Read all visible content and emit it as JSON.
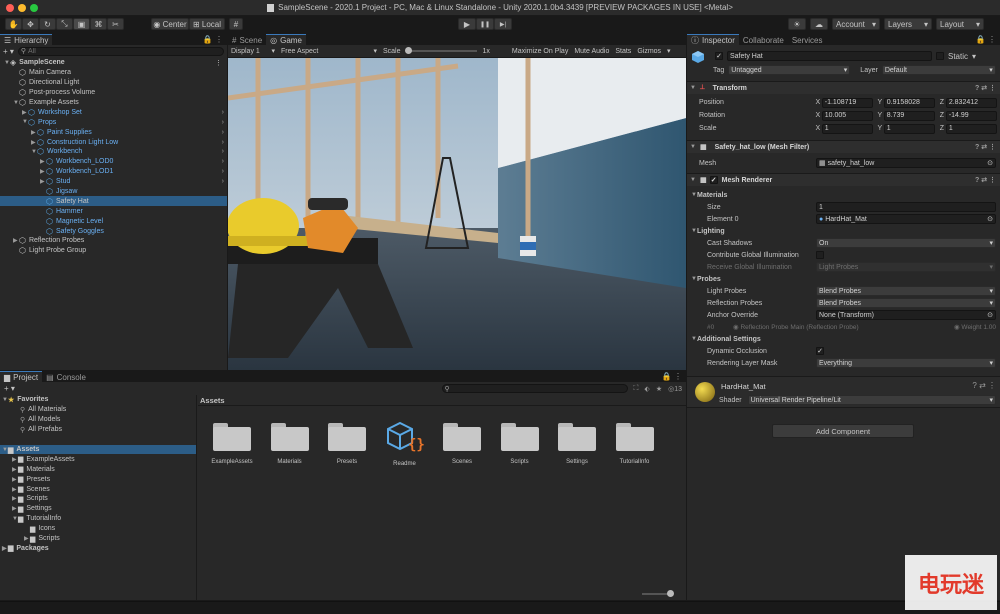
{
  "window": {
    "title": "SampleScene - 2020.1 Project - PC, Mac & Linux Standalone - Unity 2020.1.0b4.3439 [PREVIEW PACKAGES IN USE] <Metal>"
  },
  "colors": {
    "accent": "#3a79bb",
    "selection": "#2c5d87",
    "prefab_blue": "#6ab0f3",
    "panel": "#282828",
    "close": "#fe5f57",
    "minimize": "#febc2e",
    "maximize": "#28c840"
  },
  "toolbar": {
    "center": "Center",
    "local": "Local",
    "account": "Account",
    "layers": "Layers",
    "layout": "Layout",
    "play_icon": "▶",
    "pause_icon": "❚❚",
    "step_icon": "▶|"
  },
  "hierarchy": {
    "tab": "Hierarchy",
    "add": "+ ▾",
    "search_placeholder": "All",
    "rows": [
      {
        "label": "SampleScene",
        "indent": 0,
        "bold": true,
        "expanded": true
      },
      {
        "label": "Main Camera",
        "indent": 1
      },
      {
        "label": "Directional Light",
        "indent": 1
      },
      {
        "label": "Post-process Volume",
        "indent": 1
      },
      {
        "label": "Example Assets",
        "indent": 1,
        "expanded": true
      },
      {
        "label": "Workshop Set",
        "indent": 2,
        "prefab": true,
        "collapsed": true
      },
      {
        "label": "Props",
        "indent": 2,
        "prefab": true,
        "expanded": true
      },
      {
        "label": "Paint Supplies",
        "indent": 3,
        "prefab": true,
        "collapsed": true
      },
      {
        "label": "Construction Light Low",
        "indent": 3,
        "prefab": true,
        "collapsed": true
      },
      {
        "label": "Workbench",
        "indent": 3,
        "prefab": true,
        "expanded": true
      },
      {
        "label": "Workbench_LOD0",
        "indent": 4,
        "prefab": true,
        "collapsed": true
      },
      {
        "label": "Workbench_LOD1",
        "indent": 4,
        "prefab": true,
        "collapsed": true
      },
      {
        "label": "Stud",
        "indent": 4,
        "prefab": true,
        "collapsed": true
      },
      {
        "label": "Jigsaw",
        "indent": 4,
        "prefab": true
      },
      {
        "label": "Safety Hat",
        "indent": 4,
        "prefab": true,
        "selected": true
      },
      {
        "label": "Hammer",
        "indent": 4,
        "prefab": true
      },
      {
        "label": "Magnetic Level",
        "indent": 4,
        "prefab": true
      },
      {
        "label": "Safety Goggles",
        "indent": 4,
        "prefab": true
      },
      {
        "label": "Reflection Probes",
        "indent": 1,
        "collapsed": true
      },
      {
        "label": "Light Probe Group",
        "indent": 1
      }
    ]
  },
  "scene": {
    "tabs": [
      "Scene",
      "Game"
    ],
    "display": "Display 1",
    "aspect": "Free Aspect",
    "scale_label": "Scale",
    "scale_value": "1x",
    "maximize": "Maximize On Play",
    "mute": "Mute Audio",
    "stats": "Stats",
    "gizmos": "Gizmos"
  },
  "inspector": {
    "tabs": [
      "Inspector",
      "Collaborate",
      "Services"
    ],
    "object_name": "Safety Hat",
    "static": "Static",
    "tag_label": "Tag",
    "tag": "Untagged",
    "layer_label": "Layer",
    "layer": "Default",
    "transform": {
      "title": "Transform",
      "position_label": "Position",
      "rotation_label": "Rotation",
      "scale_label": "Scale",
      "x_label": "X",
      "y_label": "Y",
      "z_label": "Z",
      "pos": [
        "-1.108719",
        "0.9158028",
        "2.832412"
      ],
      "rot": [
        "10.005",
        "8.739",
        "-14.99"
      ],
      "scl": [
        "1",
        "1",
        "1"
      ]
    },
    "mesh_filter": {
      "title": "Safety_hat_low (Mesh Filter)",
      "mesh_label": "Mesh",
      "mesh": "safety_hat_low"
    },
    "mesh_renderer": {
      "title": "Mesh Renderer",
      "materials": "Materials",
      "size_label": "Size",
      "size": "1",
      "element_label": "Element 0",
      "element": "HardHat_Mat",
      "lighting": "Lighting",
      "cast_label": "Cast Shadows",
      "cast": "On",
      "contrib_label": "Contribute Global Illumination",
      "receive_label": "Receive Global Illumination",
      "receive": "Light Probes",
      "probes": "Probes",
      "lp_label": "Light Probes",
      "lp": "Blend Probes",
      "rp_label": "Reflection Probes",
      "rp": "Blend Probes",
      "anchor_label": "Anchor Override",
      "anchor": "None (Transform)",
      "probe_index": "#0",
      "probe_name": "Reflection Probe Main (Reflection Probe)",
      "probe_weight": "Weight 1.00",
      "additional": "Additional Settings",
      "dyn_label": "Dynamic Occlusion",
      "rlm_label": "Rendering Layer Mask",
      "rlm": "Everything"
    },
    "material": {
      "name": "HardHat_Mat",
      "shader_label": "Shader",
      "shader": "Universal Render Pipeline/Lit"
    },
    "add_component": "Add Component"
  },
  "project": {
    "tabs": [
      "Project",
      "Console"
    ],
    "add": "+ ▾",
    "hidden_count": "13",
    "favorites": {
      "title": "Favorites",
      "items": [
        "All Materials",
        "All Models",
        "All Prefabs"
      ]
    },
    "assets": {
      "title": "Assets",
      "items": [
        "ExampleAssets",
        "Materials",
        "Presets",
        "Scenes",
        "Scripts",
        "Settings",
        "TutorialInfo"
      ],
      "tutorial_children": [
        "Icons",
        "Scripts"
      ]
    },
    "packages": "Packages",
    "content_title": "Assets",
    "grid": [
      "ExampleAssets",
      "Materials",
      "Presets",
      "Readme",
      "Scenes",
      "Scripts",
      "Settings",
      "TutorialInfo"
    ]
  },
  "watermark": {
    "text": "电玩迷"
  }
}
